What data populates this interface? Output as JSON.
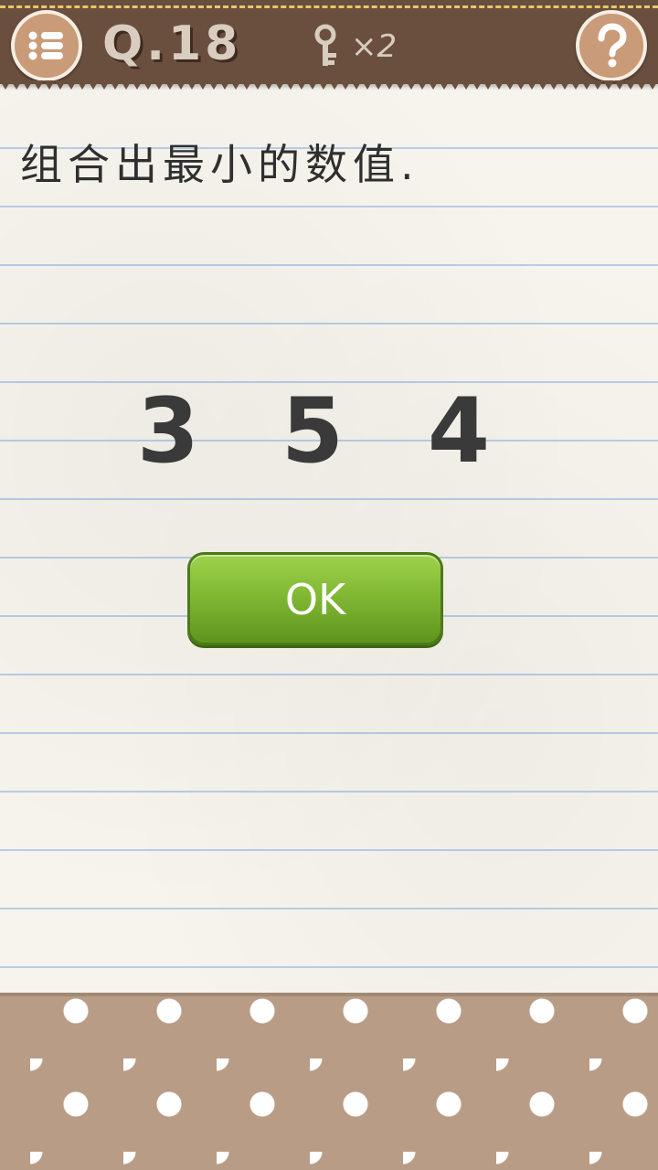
{
  "header": {
    "question_label": "Q.18",
    "key_count": "×2",
    "menu_icon": "list-menu-icon",
    "help_icon": "question-mark-icon",
    "key_icon": "key-icon"
  },
  "puzzle": {
    "prompt": "组合出最小的数值.",
    "digits": [
      "3",
      "5",
      "4"
    ],
    "ok_label": "OK"
  },
  "colors": {
    "header": "#6b4f3e",
    "button_green": "#7fb733",
    "footer": "#b89c86"
  }
}
